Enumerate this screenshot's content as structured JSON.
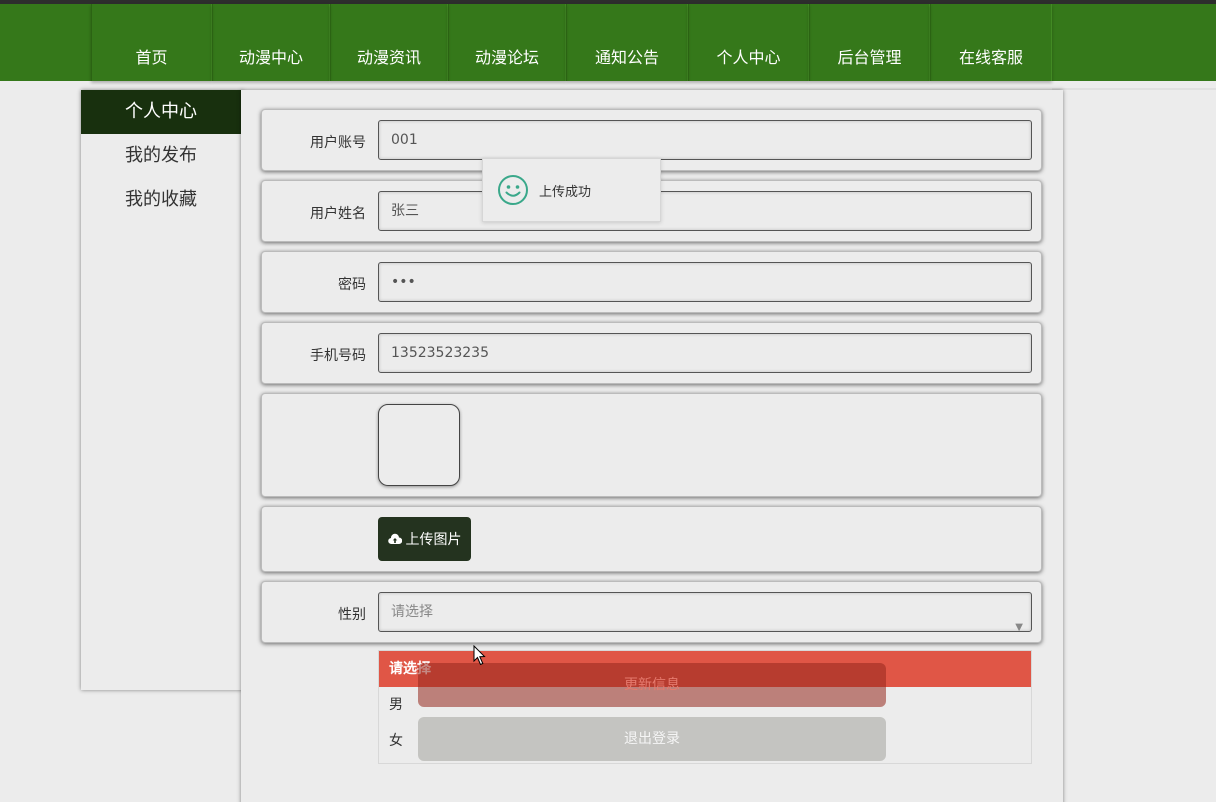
{
  "nav": {
    "items": [
      {
        "label": "首页",
        "w": 121
      },
      {
        "label": "动漫中心",
        "w": 118
      },
      {
        "label": "动漫资讯",
        "w": 118
      },
      {
        "label": "动漫论坛",
        "w": 118
      },
      {
        "label": "通知公告",
        "w": 122
      },
      {
        "label": "个人中心",
        "w": 121
      },
      {
        "label": "后台管理",
        "w": 121
      },
      {
        "label": "在线客服",
        "w": 122
      }
    ]
  },
  "sidebar": {
    "items": [
      {
        "label": "个人中心",
        "active": true
      },
      {
        "label": "我的发布",
        "active": false
      },
      {
        "label": "我的收藏",
        "active": false
      }
    ]
  },
  "form": {
    "account_label": "用户账号",
    "account_value": "001",
    "name_label": "用户姓名",
    "name_value": "张三",
    "password_label": "密码",
    "password_value": "•••",
    "phone_label": "手机号码",
    "phone_value": "13523523235",
    "upload_label": "上传图片",
    "gender_label": "性别",
    "gender_placeholder": "请选择"
  },
  "gender_dropdown": {
    "options": [
      "请选择",
      "男",
      "女"
    ],
    "selected": "请选择"
  },
  "actions": {
    "update_label": "更新信息",
    "logout_label": "退出登录"
  },
  "toast": {
    "message": "上传成功",
    "icon": "smile-icon"
  },
  "colors": {
    "nav_green": "#35781a",
    "sidebar_active": "#18300e",
    "upload_button": "#24331f",
    "dropdown_selected": "#e05646",
    "toast_icon": "#3aa88a"
  }
}
